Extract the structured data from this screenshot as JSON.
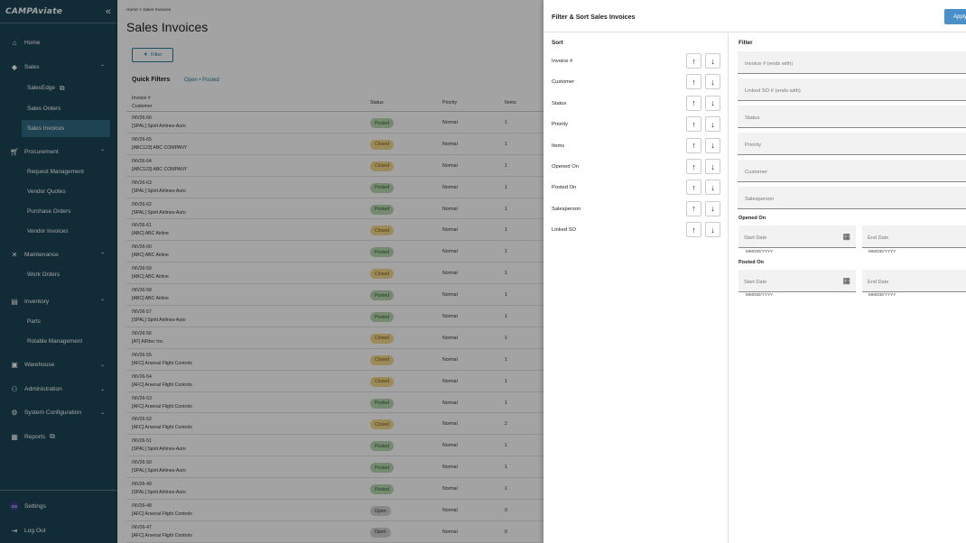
{
  "sidebar": {
    "logo": "CAMPAviate",
    "collapse_glyph": "«",
    "items": [
      {
        "label": "Home",
        "icon": "home-icon"
      },
      {
        "label": "Sales",
        "icon": "tag-icon",
        "expanded": true
      },
      {
        "label": "SalesEdge"
      },
      {
        "label": "Sales Orders"
      },
      {
        "label": "Sales Invoices",
        "active": true
      },
      {
        "label": "Procurement",
        "icon": "cart-icon",
        "expanded": true
      },
      {
        "label": "Request Management"
      },
      {
        "label": "Vendor Quotes"
      },
      {
        "label": "Purchase Orders"
      },
      {
        "label": "Vendor Invoices"
      },
      {
        "label": "Maintenance",
        "icon": "tools-icon",
        "expanded": true
      },
      {
        "label": "Work Orders"
      },
      {
        "label": "Inventory",
        "icon": "inventory-icon",
        "expanded": true
      },
      {
        "label": "Parts"
      },
      {
        "label": "Rotable Management"
      },
      {
        "label": "Warehouse",
        "icon": "warehouse-icon",
        "expanded": false
      },
      {
        "label": "Administration",
        "icon": "admin-icon",
        "expanded": false
      },
      {
        "label": "System Configuration",
        "icon": "gear-icon",
        "expanded": false
      },
      {
        "label": "Reports",
        "icon": "report-icon"
      }
    ],
    "settings_label": "Settings",
    "avatar_initials": "DS",
    "logout_label": "Log Out"
  },
  "main": {
    "breadcrumb": [
      "Home",
      "Sales Invoices"
    ],
    "title": "Sales Invoices",
    "filter_button": "Filter",
    "quick_filters_label": "Quick Filters",
    "quick_filter_chips": "Open  •  Posted",
    "columns": {
      "invoice": "Invoice #",
      "customer": "Customer",
      "status": "Status",
      "priority": "Priority",
      "items": "Items"
    },
    "rows": [
      {
        "inv": "INV26-66",
        "cust": "[SPAL] Spirit Airlines-Auto",
        "status": "Posted",
        "priority": "Normal",
        "items": "1"
      },
      {
        "inv": "INV26-65",
        "cust": "[ABC123] ABC COMPANY",
        "status": "Closed",
        "priority": "Normal",
        "items": "1"
      },
      {
        "inv": "INV26-64",
        "cust": "[ABC123] ABC COMPANY",
        "status": "Closed",
        "priority": "Normal",
        "items": "1"
      },
      {
        "inv": "INV26-63",
        "cust": "[SPAL] Spirit Airlines-Auto",
        "status": "Posted",
        "priority": "Normal",
        "items": "1"
      },
      {
        "inv": "INV26-62",
        "cust": "[SPAL] Spirit Airlines-Auto",
        "status": "Posted",
        "priority": "Normal",
        "items": "1"
      },
      {
        "inv": "INV26-61",
        "cust": "[ABC] ABC Airline",
        "status": "Closed",
        "priority": "Normal",
        "items": "1"
      },
      {
        "inv": "INV26-60",
        "cust": "[ABC] ABC Airline",
        "status": "Posted",
        "priority": "Normal",
        "items": "1"
      },
      {
        "inv": "INV26-59",
        "cust": "[ABC] ABC Airline",
        "status": "Closed",
        "priority": "Normal",
        "items": "1"
      },
      {
        "inv": "INV26-58",
        "cust": "[ABC] ABC Airline",
        "status": "Posted",
        "priority": "Normal",
        "items": "1"
      },
      {
        "inv": "INV26-57",
        "cust": "[SPAL] Spirit Airlines-Auto",
        "status": "Posted",
        "priority": "Normal",
        "items": "1"
      },
      {
        "inv": "INV26-56",
        "cust": "[AT] AIRtec Inc.",
        "status": "Closed",
        "priority": "Normal",
        "items": "1"
      },
      {
        "inv": "INV26-55",
        "cust": "[AFC] Arsenal Flight Controls",
        "status": "Closed",
        "priority": "Normal",
        "items": "1"
      },
      {
        "inv": "INV26-54",
        "cust": "[AFC] Arsenal Flight Controls",
        "status": "Closed",
        "priority": "Normal",
        "items": "1"
      },
      {
        "inv": "INV26-53",
        "cust": "[AFC] Arsenal Flight Controls",
        "status": "Posted",
        "priority": "Normal",
        "items": "1"
      },
      {
        "inv": "INV26-52",
        "cust": "[AFC] Arsenal Flight Controls",
        "status": "Closed",
        "priority": "Normal",
        "items": "2"
      },
      {
        "inv": "INV26-51",
        "cust": "[SPAL] Spirit Airlines-Auto",
        "status": "Posted",
        "priority": "Normal",
        "items": "1"
      },
      {
        "inv": "INV26-50",
        "cust": "[SPAL] Spirit Airlines-Auto",
        "status": "Posted",
        "priority": "Normal",
        "items": "1"
      },
      {
        "inv": "INV26-49",
        "cust": "[SPAL] Spirit Airlines-Auto",
        "status": "Posted",
        "priority": "Normal",
        "items": "1"
      },
      {
        "inv": "INV26-48",
        "cust": "[AFC] Arsenal Flight Controls",
        "status": "Open",
        "priority": "Normal",
        "items": "0"
      },
      {
        "inv": "INV26-47",
        "cust": "[AFC] Arsenal Flight Controls",
        "status": "Open",
        "priority": "Normal",
        "items": "0"
      }
    ]
  },
  "drawer": {
    "title": "Filter & Sort Sales Invoices",
    "apply_label": "Apply",
    "sort_title": "Sort",
    "sort_fields": [
      "Invoice #",
      "Customer",
      "Status",
      "Priority",
      "Items",
      "Opened On",
      "Posted On",
      "Salesperson",
      "Linked SO"
    ],
    "filter_title": "Filter",
    "filter_fields": [
      {
        "placeholder": "Invoice # (ends with)"
      },
      {
        "placeholder": "Linked SO # (ends with)"
      },
      {
        "placeholder": "Status"
      },
      {
        "placeholder": "Priority"
      },
      {
        "placeholder": "Customer",
        "end_glyph": "c"
      },
      {
        "placeholder": "Salesperson",
        "end_glyph": "c"
      }
    ],
    "opened_on_label": "Opened On",
    "posted_on_label": "Posted On",
    "start_date": "Start Date",
    "end_date": "End Date",
    "date_format": "MM/DD/YYYY"
  },
  "colors": {
    "sidebar_bg": "#1b4657",
    "active_item": "#2f6a80",
    "accent": "#2a7a9a",
    "apply_button": "#4a90c8",
    "posted_badge": "#b9d8b3",
    "closed_badge": "#f3d88d",
    "open_badge": "#d4d4d4"
  }
}
